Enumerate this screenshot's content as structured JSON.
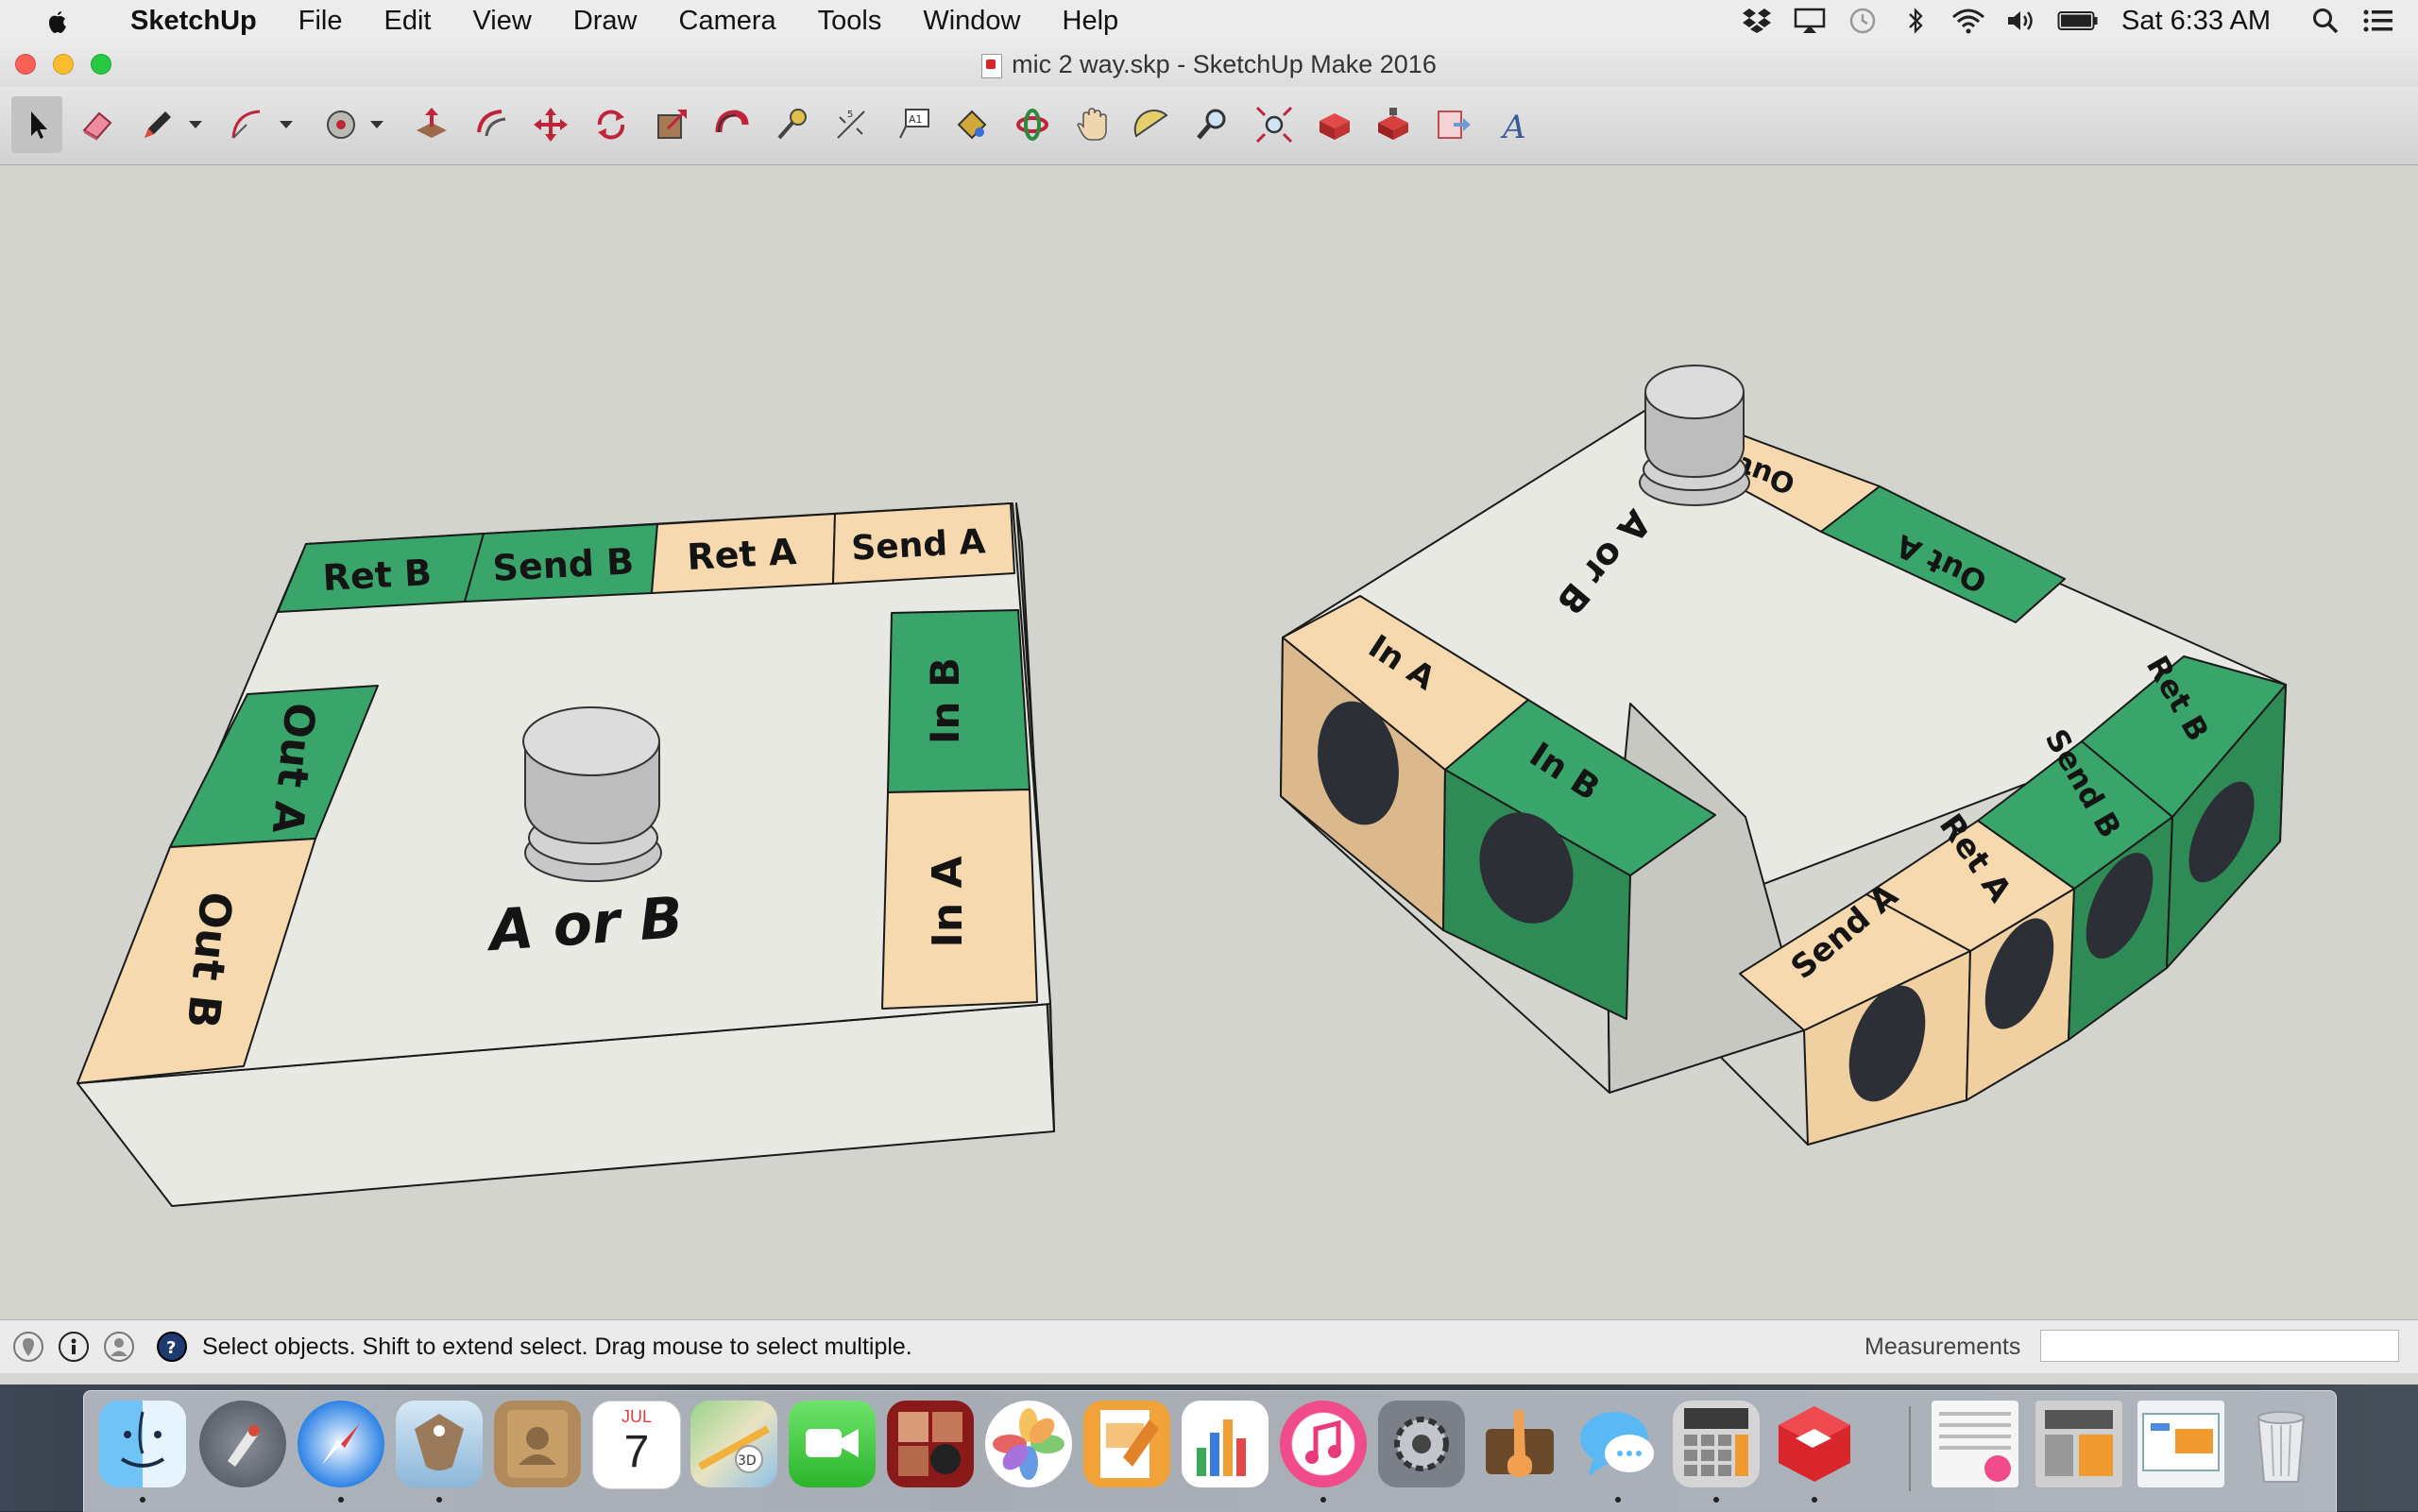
{
  "menubar": {
    "app_name": "SketchUp",
    "menus": [
      "File",
      "Edit",
      "View",
      "Draw",
      "Camera",
      "Tools",
      "Window",
      "Help"
    ],
    "status_icons": [
      "dropbox-icon",
      "airplay-icon",
      "time-machine-icon",
      "bluetooth-icon",
      "wifi-icon",
      "volume-icon",
      "battery-icon"
    ],
    "clock": "Sat 6:33 AM"
  },
  "window": {
    "title": "mic 2 way.skp - SketchUp Make 2016"
  },
  "toolbar": {
    "tools": [
      "select-tool",
      "eraser-tool",
      "line-tool",
      "arc-tool",
      "shapes-tool",
      "push-pull-tool",
      "offset-tool",
      "move-tool",
      "rotate-tool",
      "scale-tool",
      "follow-me-tool",
      "tape-measure-tool",
      "dimension-tool",
      "text-tool",
      "paint-bucket-tool",
      "orbit-tool",
      "pan-tool",
      "protractor-tool",
      "zoom-tool",
      "zoom-extents-tool",
      "3d-warehouse-tool",
      "extension-warehouse-tool",
      "send-to-layout-tool",
      "3d-text-tool"
    ]
  },
  "model": {
    "box_left": {
      "labels": [
        "Ret B",
        "Send B",
        "Ret A",
        "Send A",
        "Out A",
        "Out B",
        "In B",
        "In A",
        "A or B"
      ]
    },
    "box_right": {
      "labels": [
        "Out B",
        "Out A",
        "A or B",
        "In A",
        "In B",
        "Ret B",
        "Send B",
        "Ret A",
        "Send A"
      ]
    },
    "colors": {
      "green": "#3aa56b",
      "peach": "#f6d9ae",
      "panel": "#e9e9e4",
      "side": "#bdbdb7"
    }
  },
  "statusbar": {
    "message": "Select objects. Shift to extend select. Drag mouse to select multiple.",
    "measurements_label": "Measurements",
    "measurements_value": ""
  },
  "dock": {
    "apps": [
      "finder-icon",
      "launchpad-icon",
      "safari-icon",
      "mail-icon",
      "contacts-icon",
      "calendar-icon",
      "maps-icon",
      "facetime-icon",
      "photo-booth-icon",
      "photos-icon",
      "pages-icon",
      "numbers-icon",
      "itunes-icon",
      "system-preferences-icon",
      "garageband-icon",
      "messages-icon",
      "calculator-icon",
      "sketchup-icon"
    ],
    "calendar_month": "JUL",
    "calendar_day": "7",
    "recents": [
      "recent-document-1-icon",
      "recent-document-2-icon",
      "recent-document-3-icon"
    ],
    "trash": "trash-icon"
  }
}
